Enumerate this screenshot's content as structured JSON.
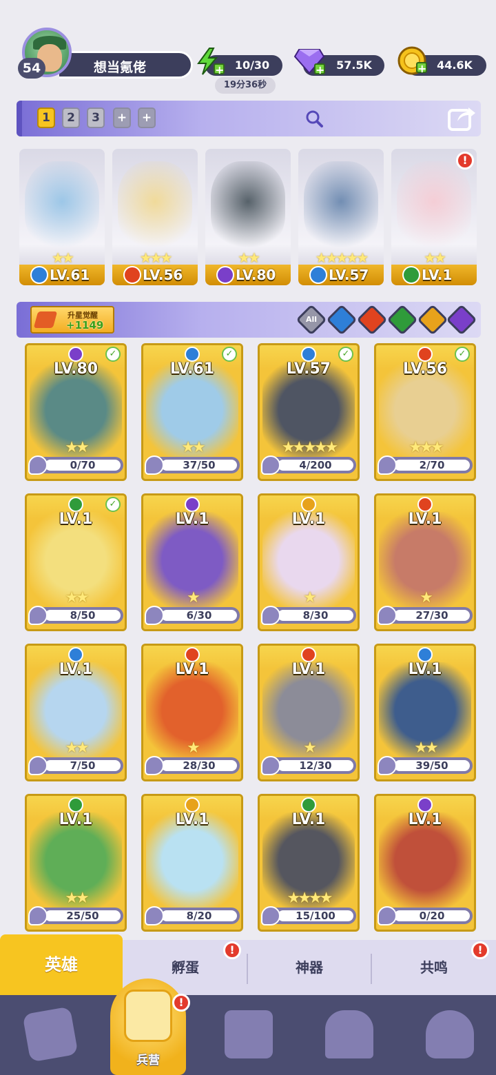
{
  "player": {
    "name": "想当氪佬",
    "level": "54"
  },
  "resources": {
    "energy": {
      "value": "10/30",
      "timer": "19分36秒",
      "icon": "lightning-icon"
    },
    "gems": {
      "value": "57.5K",
      "icon": "diamond-icon"
    },
    "coins": {
      "value": "44.6K",
      "icon": "coin-icon"
    }
  },
  "team": {
    "tabs": [
      "1",
      "2",
      "3",
      "+",
      "+"
    ],
    "active_tab": "1",
    "members": [
      {
        "level": "LV.61",
        "element": "water",
        "stars": "★★",
        "alert": false
      },
      {
        "level": "LV.56",
        "element": "fire",
        "stars": "★★★",
        "alert": false
      },
      {
        "level": "LV.80",
        "element": "dark",
        "stars": "★★",
        "alert": false
      },
      {
        "level": "LV.57",
        "element": "water",
        "stars": "★★★★★",
        "alert": false
      },
      {
        "level": "LV.1",
        "element": "nature",
        "stars": "★★",
        "alert": true
      }
    ]
  },
  "filter": {
    "awaken_label": "升星觉醒",
    "awaken_count": "+1149",
    "elements": [
      "All",
      "water",
      "fire",
      "nature",
      "light",
      "dark"
    ]
  },
  "elements": {
    "water": "#2e7fd8",
    "fire": "#e0431f",
    "nature": "#2f9b3a",
    "light": "#e7a21b",
    "dark": "#7a3fc9",
    "all": "#7b7b8f"
  },
  "heroes": [
    {
      "level": "LV.80",
      "element": "dark",
      "shards": "0/70",
      "progress": 0,
      "stars": "★★",
      "checked": true,
      "art": "#5a8a86"
    },
    {
      "level": "LV.61",
      "element": "water",
      "shards": "37/50",
      "progress": 0.74,
      "stars": "★★",
      "checked": true,
      "art": "#9fcbe8"
    },
    {
      "level": "LV.57",
      "element": "water",
      "shards": "4/200",
      "progress": 0.02,
      "stars": "★★★★★",
      "checked": true,
      "art": "#4f5563"
    },
    {
      "level": "LV.56",
      "element": "fire",
      "shards": "2/70",
      "progress": 0.03,
      "stars": "★★★",
      "checked": true,
      "art": "#e8cf92"
    },
    {
      "level": "LV.1",
      "element": "nature",
      "shards": "8/50",
      "progress": 0.16,
      "stars": "★★",
      "checked": true,
      "art": "#f3df7e"
    },
    {
      "level": "LV.1",
      "element": "dark",
      "shards": "6/30",
      "progress": 0.2,
      "stars": "★",
      "checked": false,
      "art": "#7e5bc4"
    },
    {
      "level": "LV.1",
      "element": "light",
      "shards": "8/30",
      "progress": 0.27,
      "stars": "★",
      "checked": false,
      "art": "#e9d8ee"
    },
    {
      "level": "LV.1",
      "element": "fire",
      "shards": "27/30",
      "progress": 0.9,
      "stars": "★",
      "checked": false,
      "art": "#c77b68"
    },
    {
      "level": "LV.1",
      "element": "water",
      "shards": "7/50",
      "progress": 0.14,
      "stars": "★★",
      "checked": false,
      "art": "#b6d6ef"
    },
    {
      "level": "LV.1",
      "element": "fire",
      "shards": "28/30",
      "progress": 0.93,
      "stars": "★",
      "checked": false,
      "art": "#e2612c"
    },
    {
      "level": "LV.1",
      "element": "fire",
      "shards": "12/30",
      "progress": 0.4,
      "stars": "★",
      "checked": false,
      "art": "#8c8c98"
    },
    {
      "level": "LV.1",
      "element": "water",
      "shards": "39/50",
      "progress": 0.78,
      "stars": "★★",
      "checked": false,
      "art": "#3e5d8d"
    },
    {
      "level": "LV.1",
      "element": "nature",
      "shards": "25/50",
      "progress": 0.5,
      "stars": "★★",
      "checked": false,
      "art": "#5fae57"
    },
    {
      "level": "LV.1",
      "element": "light",
      "shards": "8/20",
      "progress": 0.4,
      "stars": "",
      "checked": false,
      "art": "#b9e1f2"
    },
    {
      "level": "LV.1",
      "element": "nature",
      "shards": "15/100",
      "progress": 0.15,
      "stars": "★★★★",
      "checked": false,
      "art": "#55565f"
    },
    {
      "level": "LV.1",
      "element": "dark",
      "shards": "0/20",
      "progress": 0,
      "stars": "",
      "checked": false,
      "art": "#c0503a"
    }
  ],
  "subtabs": [
    {
      "label": "英雄",
      "active": true,
      "alert": false
    },
    {
      "label": "孵蛋",
      "active": false,
      "alert": true
    },
    {
      "label": "神器",
      "active": false,
      "alert": false
    },
    {
      "label": "共鸣",
      "active": false,
      "alert": true
    }
  ],
  "bottom_nav": {
    "items": [
      "cards-icon",
      "barracks-icon",
      "map-icon",
      "castle-icon",
      "mushroom-icon"
    ],
    "active_label": "兵营"
  }
}
